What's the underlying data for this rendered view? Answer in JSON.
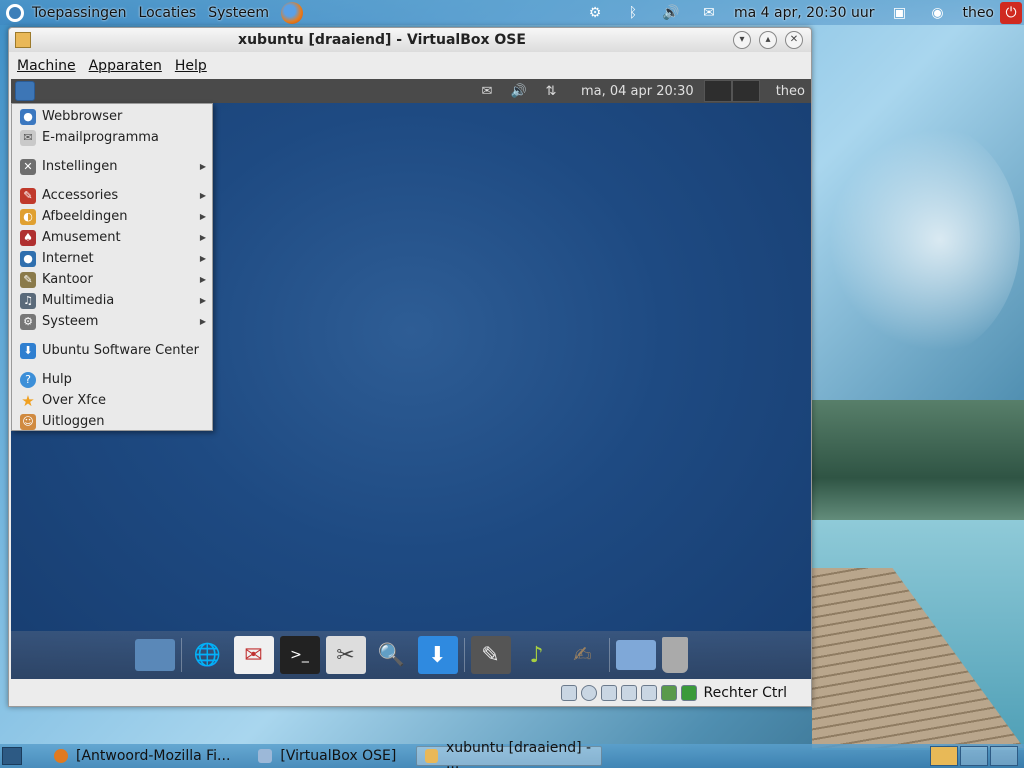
{
  "host_panel": {
    "menus": [
      "Toepassingen",
      "Locaties",
      "Systeem"
    ],
    "clock": "ma  4 apr, 20:30 uur",
    "user": "theo"
  },
  "vbox": {
    "title": "xubuntu [draaiend] - VirtualBox OSE",
    "menus": [
      "Machine",
      "Apparaten",
      "Help"
    ],
    "host_key": "Rechter Ctrl"
  },
  "guest_panel": {
    "clock": "ma, 04 apr  20:30",
    "user": "theo"
  },
  "app_menu": {
    "items": [
      {
        "label": "Webbrowser",
        "icon": "globe-icon",
        "submenu": false
      },
      {
        "label": "E-mailprogramma",
        "icon": "mail-icon",
        "submenu": false
      },
      {
        "label": "Instellingen",
        "icon": "settings-icon",
        "submenu": true
      },
      {
        "label": "Accessories",
        "icon": "accessories-icon",
        "submenu": true
      },
      {
        "label": "Afbeeldingen",
        "icon": "graphics-icon",
        "submenu": true
      },
      {
        "label": "Amusement",
        "icon": "games-icon",
        "submenu": true
      },
      {
        "label": "Internet",
        "icon": "internet-icon",
        "submenu": true
      },
      {
        "label": "Kantoor",
        "icon": "office-icon",
        "submenu": true
      },
      {
        "label": "Multimedia",
        "icon": "multimedia-icon",
        "submenu": true
      },
      {
        "label": "Systeem",
        "icon": "system-icon",
        "submenu": true
      },
      {
        "label": "Ubuntu Software Center",
        "icon": "software-center-icon",
        "submenu": false
      },
      {
        "label": "Hulp",
        "icon": "help-icon",
        "submenu": false
      },
      {
        "label": "Over Xfce",
        "icon": "star-icon",
        "submenu": false
      },
      {
        "label": "Uitloggen",
        "icon": "logout-icon",
        "submenu": false
      }
    ]
  },
  "taskbar": {
    "tasks": [
      {
        "label": "[Antwoord-Mozilla Fi...",
        "active": false
      },
      {
        "label": "[VirtualBox OSE]",
        "active": false
      },
      {
        "label": "xubuntu [draaiend] - ...",
        "active": true
      }
    ]
  }
}
